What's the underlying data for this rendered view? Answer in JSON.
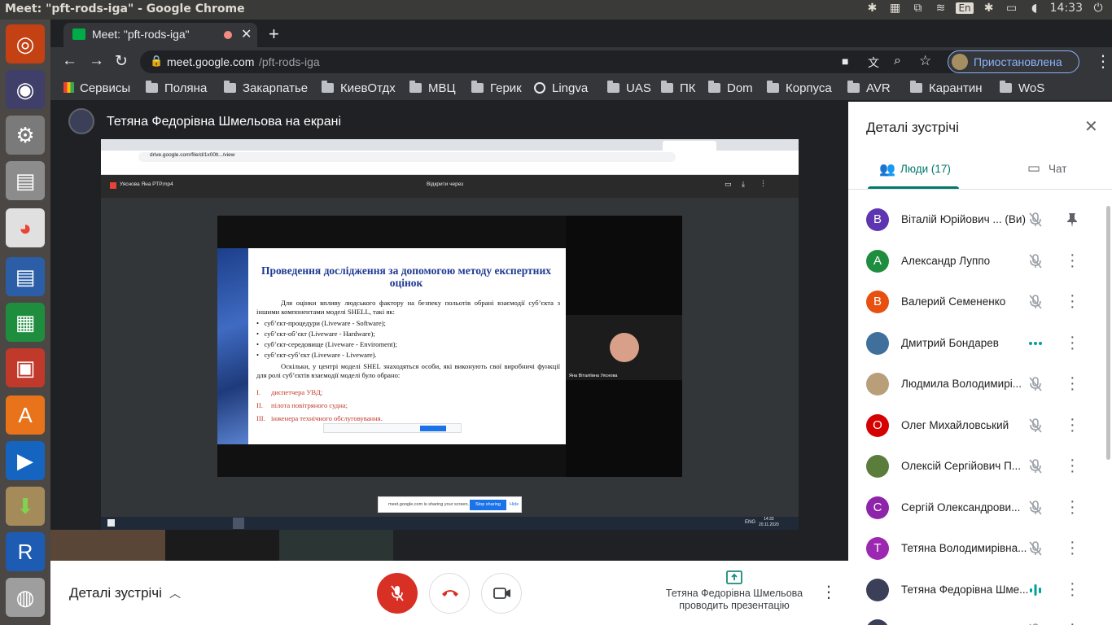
{
  "os": {
    "window_title": "Meet: \"pft-rods-iga\" - Google Chrome",
    "keyboard_layout": "En",
    "clock": "14:33"
  },
  "browser": {
    "tab_title": "Meet: \"pft-rods-iga\"",
    "url_domain": "meet.google.com",
    "url_path": "/pft-rods-iga",
    "profile_label": "Приостановлена",
    "bookmarks": [
      {
        "label": "Сервисы",
        "icon": "apps-grid-icon"
      },
      {
        "label": "Поляна",
        "icon": "folder-icon"
      },
      {
        "label": "Закарпатье",
        "icon": "folder-icon"
      },
      {
        "label": "КиевОтдх",
        "icon": "folder-icon"
      },
      {
        "label": "МВЦ",
        "icon": "folder-icon"
      },
      {
        "label": "Герик",
        "icon": "folder-icon"
      },
      {
        "label": "Lingva",
        "icon": "globe-icon"
      },
      {
        "label": "UAS",
        "icon": "folder-icon"
      },
      {
        "label": "ПК",
        "icon": "folder-icon"
      },
      {
        "label": "Dom",
        "icon": "folder-icon"
      },
      {
        "label": "Корпуса",
        "icon": "folder-icon"
      },
      {
        "label": "AVR",
        "icon": "folder-icon"
      },
      {
        "label": "Карантин",
        "icon": "folder-icon"
      },
      {
        "label": "WoS",
        "icon": "folder-icon"
      }
    ]
  },
  "meet": {
    "presenter_caption": "Тетяна Федорівна Шмельова на екрані",
    "shared": {
      "inner_url": "drive.google.com/file/d/1x00lt.../view",
      "video_title": "Уяснова Яна РТР.mp4",
      "open_with": "Відкрити через",
      "slide_title": "Проведення дослідження за допомогою методу експертних оцінок",
      "slide_para1": "Для оцінки впливу людського фактору на безпеку польотів обрані взаємодії суб’єкта з іншими компонентами моделі SHELL, такі як:",
      "slide_bullets": [
        "суб’єкт-процедури (Liveware - Software);",
        "суб’єкт-об’єкт (Liveware - Hardware);",
        "суб’єкт-середовище (Liveware - Enviroment);",
        "суб’єкт-суб’єкт (Liveware - Liveware)."
      ],
      "slide_para2": "Оскільки, у центрі моделі SHEL знаходяться особи, які виконують свої виробничі функції для ролі суб’єктів взаємодії моделі було обрано:",
      "slide_roles": [
        {
          "num": "I.",
          "text": "диспетчера УВД;"
        },
        {
          "num": "II.",
          "text": "пілота повітряного судна;"
        },
        {
          "num": "III.",
          "text": "інженера технічного обслуговування."
        }
      ],
      "participant_tile_name": "Яна Віталіївна Уяснова",
      "sharing_notice": "meet.google.com is sharing your screen.",
      "stop_sharing": "Stop sharing",
      "hide": "Hide",
      "taskbar_time": "14:33",
      "taskbar_date": "20.11.2020",
      "taskbar_lang": "ENG"
    },
    "bottom": {
      "details_label": "Деталі зустрічі",
      "presenting_line1": "Тетяна Федорівна Шмельова",
      "presenting_line2": "проводить презентацію"
    },
    "panel": {
      "title": "Деталі зустрічі",
      "tab_people": "Люди (17)",
      "tab_chat": "Чат",
      "people": [
        {
          "name": "Віталій Юрійович ...",
          "suffix": "(Ви)",
          "avatar_letter": "В",
          "avatar_color": "#5e35b1",
          "mic": "muted",
          "action": "pin"
        },
        {
          "name": "Александр Луппо",
          "avatar_letter": "А",
          "avatar_color": "#1e8e3e",
          "mic": "muted",
          "action": "more"
        },
        {
          "name": "Валерий Семененко",
          "avatar_letter": "В",
          "avatar_color": "#e8500f",
          "mic": "muted",
          "action": "more"
        },
        {
          "name": "Дмитрий Бондарев",
          "avatar_letter": "",
          "avatar_color": "#3f6f9a",
          "mic": "active-dots",
          "action": "more"
        },
        {
          "name": "Людмила Володимирі...",
          "avatar_letter": "",
          "avatar_color": "#b89f7a",
          "mic": "muted",
          "action": "more"
        },
        {
          "name": "Олег Михайловський",
          "avatar_letter": "О",
          "avatar_color": "#d50000",
          "mic": "muted",
          "action": "more"
        },
        {
          "name": "Олексій Сергійович П...",
          "avatar_letter": "",
          "avatar_color": "#5b7d3b",
          "mic": "muted",
          "action": "more"
        },
        {
          "name": "Сергій Олександрови...",
          "avatar_letter": "С",
          "avatar_color": "#8e24aa",
          "mic": "muted",
          "action": "more"
        },
        {
          "name": "Тетяна Володимирівна...",
          "avatar_letter": "Т",
          "avatar_color": "#9c27b0",
          "mic": "muted",
          "action": "more"
        },
        {
          "name": "Тетяна Федорівна Шме...",
          "avatar_letter": "",
          "avatar_color": "#3b3f58",
          "mic": "speaking",
          "action": "more"
        },
        {
          "name": "Тетяна Федорівна Шме...",
          "avatar_letter": "",
          "avatar_color": "#3b3f58",
          "mic": "muted",
          "action": "more"
        }
      ]
    }
  }
}
